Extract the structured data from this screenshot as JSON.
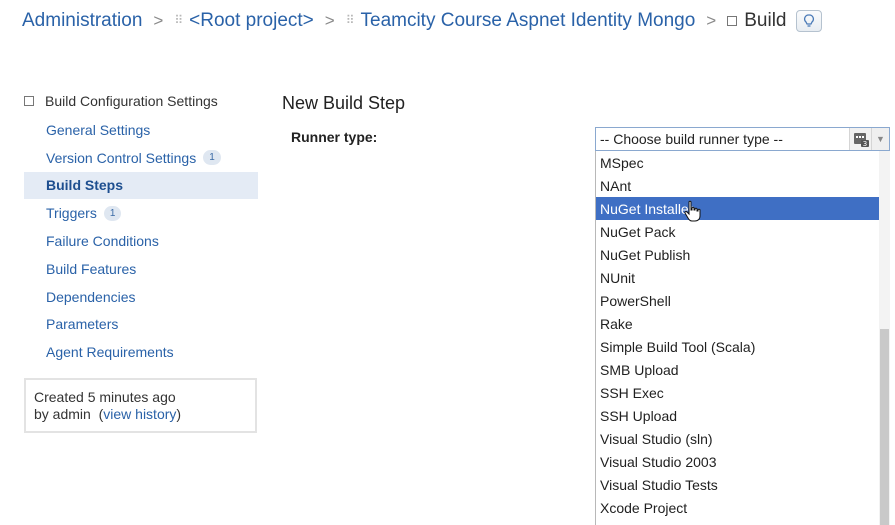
{
  "breadcrumb": {
    "administration": "Administration",
    "separator": ">",
    "root_project": "<Root project>",
    "project": "Teamcity Course Aspnet Identity Mongo",
    "current": "Build"
  },
  "sidebar": {
    "header": "Build Configuration Settings",
    "items": [
      {
        "label": "General Settings",
        "badge": ""
      },
      {
        "label": "Version Control Settings",
        "badge": "1"
      },
      {
        "label": "Build Steps",
        "badge": ""
      },
      {
        "label": "Triggers",
        "badge": "1"
      },
      {
        "label": "Failure Conditions",
        "badge": ""
      },
      {
        "label": "Build Features",
        "badge": ""
      },
      {
        "label": "Dependencies",
        "badge": ""
      },
      {
        "label": "Parameters",
        "badge": ""
      },
      {
        "label": "Agent Requirements",
        "badge": ""
      }
    ],
    "active_item": "Build Steps",
    "history": {
      "created": "Created 5 minutes ago",
      "by": "by admin",
      "open_paren": "(",
      "link": "view history",
      "close_paren": ")"
    }
  },
  "main": {
    "title": "New Build Step",
    "runner_label": "Runner type:"
  },
  "runner_select": {
    "value": "-- Choose build runner type --",
    "icon_badge": "3",
    "options": [
      "MSpec",
      "NAnt",
      "NuGet Installer",
      "NuGet Pack",
      "NuGet Publish",
      "NUnit",
      "PowerShell",
      "Rake",
      "Simple Build Tool (Scala)",
      "SMB Upload",
      "SSH Exec",
      "SSH Upload",
      "Visual Studio (sln)",
      "Visual Studio 2003",
      "Visual Studio Tests",
      "Xcode Project"
    ],
    "highlighted": "NuGet Installer"
  },
  "colors": {
    "link": "#2a62a8",
    "highlight": "#3f6fc4",
    "active_sidebar_bg": "#e4ebf5"
  }
}
